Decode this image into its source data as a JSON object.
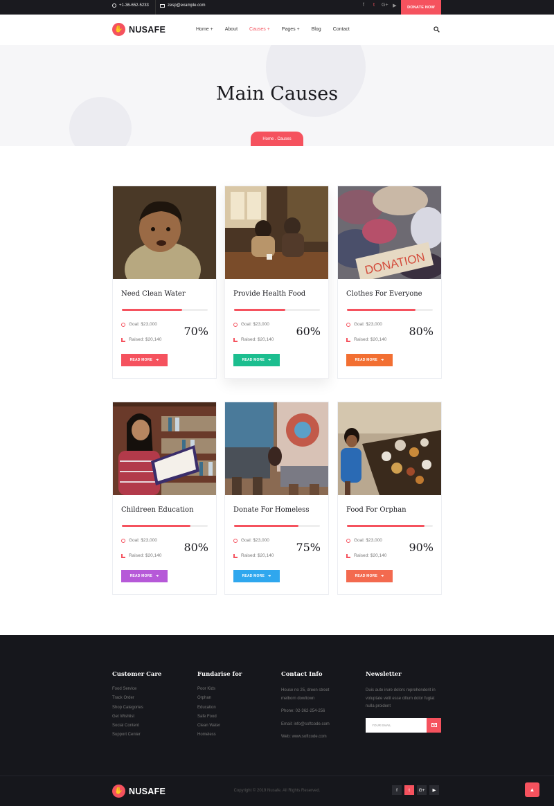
{
  "topbar": {
    "phone": "+1-36-652-5233",
    "email": "zesp@example.com",
    "socials": [
      "f",
      "t",
      "G+",
      "▶"
    ],
    "donate_label": "DONATE NOW"
  },
  "header": {
    "logo_text": "NUSAFE",
    "nav": [
      {
        "label": "Home +"
      },
      {
        "label": "About"
      },
      {
        "label": "Causes +"
      },
      {
        "label": "Pages +"
      },
      {
        "label": "Blog"
      },
      {
        "label": "Contact"
      }
    ]
  },
  "hero": {
    "title": "Main Causes",
    "breadcrumb": "Home . Causes"
  },
  "colors": {
    "accent": "#f5525e",
    "green": "#1cbe8f",
    "orange": "#f26f32",
    "purple": "#b659d8",
    "blue": "#2fa7ee",
    "coral": "#f36a4f"
  },
  "causes": [
    {
      "title": "Need Clean Water",
      "goal": "Goal: $23,000",
      "raised": "Raised: $20,140",
      "percent": "70%",
      "progress": 0.7,
      "button": "READ MORE",
      "button_color": "#f5525e"
    },
    {
      "title": "Provide Health Food",
      "goal": "Goal: $23,000",
      "raised": "Raised: $20,140",
      "percent": "60%",
      "progress": 0.6,
      "button": "READ MORE",
      "button_color": "#1cbe8f"
    },
    {
      "title": "Clothes For Everyone",
      "goal": "Goal: $23,000",
      "raised": "Raised: $20,140",
      "percent": "80%",
      "progress": 0.8,
      "button": "READ MORE",
      "button_color": "#f26f32",
      "image_text": "DONATION"
    },
    {
      "title": "Childreen Education",
      "goal": "Goal: $23,000",
      "raised": "Raised: $20,140",
      "percent": "80%",
      "progress": 0.8,
      "button": "READ MORE",
      "button_color": "#b659d8"
    },
    {
      "title": "Donate For Homeless",
      "goal": "Goal: $23,000",
      "raised": "Raised: $20,140",
      "percent": "75%",
      "progress": 0.75,
      "button": "READ MORE",
      "button_color": "#2fa7ee"
    },
    {
      "title": "Food For Orphan",
      "goal": "Goal: $23,000",
      "raised": "Raised: $20,140",
      "percent": "90%",
      "progress": 0.9,
      "button": "READ MORE",
      "button_color": "#f36a4f"
    }
  ],
  "footer": {
    "customer_care": {
      "title": "Customer Care",
      "items": [
        "Food Service",
        "Track Order",
        "Shop Categories",
        "Get Wishlist",
        "Social Content",
        "Support Center"
      ]
    },
    "fundraise": {
      "title": "Fundarise for",
      "items": [
        "Poor Kids",
        "Orphan",
        "Education",
        "Safe Food",
        "Clean Water",
        "Homeless"
      ]
    },
    "contact": {
      "title": "Contact Info",
      "address": "House no 25, dreen street melborn dowltown",
      "phone": "Phone: 02-362-254-256",
      "email": "Email: info@softcode.com",
      "web": "Web: www.softcode.com"
    },
    "newsletter": {
      "title": "Newsletter",
      "text": "Duis aute irure dolors reprehenderit in voluptate velit esse cillum dolor fugiat nulla proident",
      "placeholder": "YOUR EMAIL"
    },
    "logo_text": "NUSAFE",
    "copyright": "Copyright © 2019 Nusafe. All Rights Reserved.",
    "socials": [
      "f",
      "t",
      "G+",
      "▶"
    ]
  }
}
